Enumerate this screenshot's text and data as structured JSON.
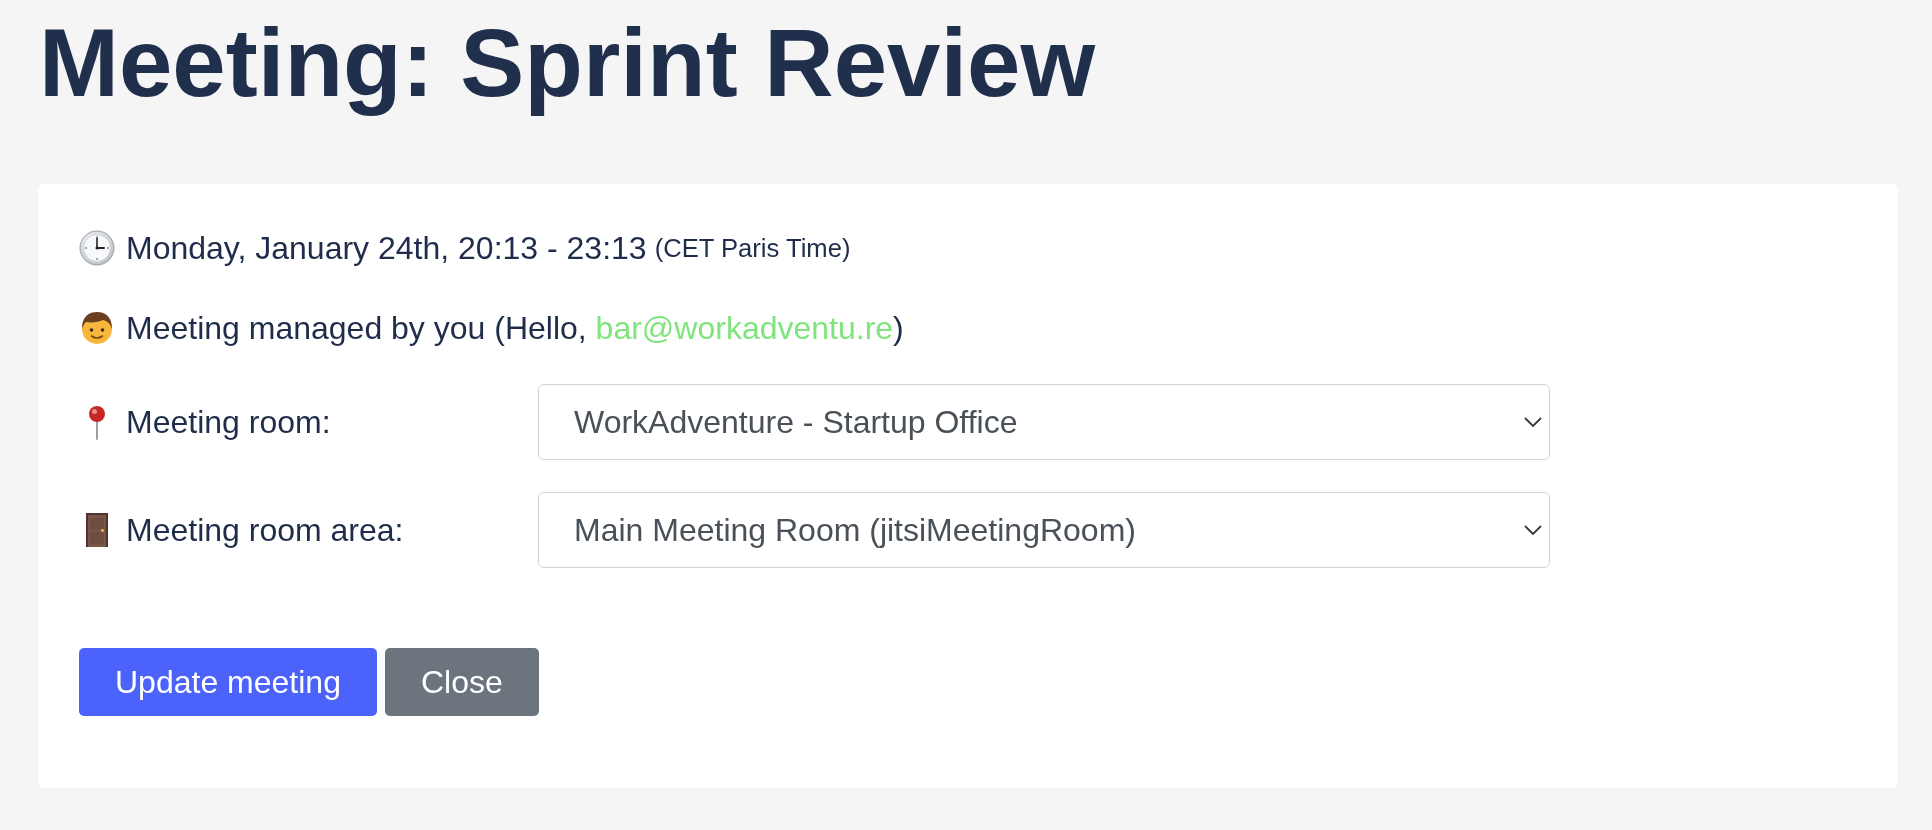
{
  "title": "Meeting: Sprint Review",
  "schedule": {
    "time": "Monday, January 24th, 20:13 - 23:13",
    "timezone": "(CET Paris Time)"
  },
  "manager": {
    "text_before": "Meeting managed by you (Hello, ",
    "email": "bar@workadventu.re",
    "text_after": ")"
  },
  "fields": [
    {
      "label": "Meeting room:",
      "value": "WorkAdventure - Startup Office"
    },
    {
      "label": "Meeting room area:",
      "value": "Main Meeting Room (jitsiMeetingRoom)"
    }
  ],
  "buttons": [
    {
      "label": "Update meeting",
      "kind": "primary"
    },
    {
      "label": "Close",
      "kind": "secondary"
    }
  ]
}
